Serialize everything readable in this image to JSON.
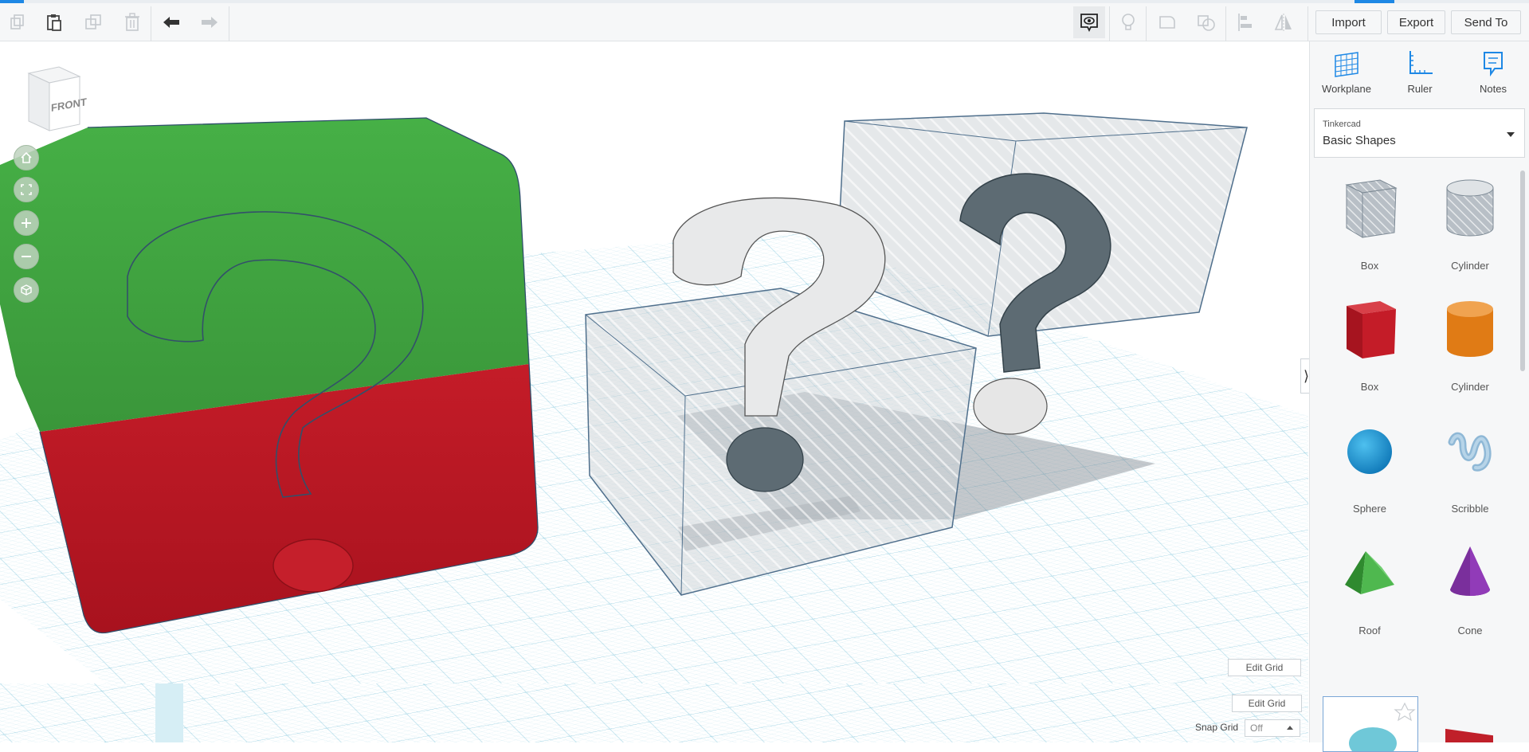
{
  "toolbar": {
    "icons": [
      "copy-icon",
      "paste-icon",
      "duplicate-icon",
      "delete-icon",
      "undo-icon",
      "redo-icon"
    ],
    "right_icons": [
      "show-all-icon",
      "light-bulb-icon",
      "group-icon",
      "ungroup-icon",
      "align-icon",
      "mirror-icon"
    ],
    "import_label": "Import",
    "export_label": "Export",
    "send_to_label": "Send To"
  },
  "viewport": {
    "viewcube_label": "FRONT",
    "nav_icons": [
      "home-icon",
      "fit-icon",
      "zoom-in-icon",
      "zoom-out-icon",
      "perspective-icon"
    ],
    "edit_grid_label": "Edit Grid"
  },
  "bottom_bar": {
    "edit_grid_label": "Edit Grid",
    "snap_grid_label": "Snap Grid",
    "snap_grid_value": "Off"
  },
  "panel": {
    "tools": [
      {
        "icon": "workplane-icon",
        "label": "Workplane"
      },
      {
        "icon": "ruler-icon",
        "label": "Ruler"
      },
      {
        "icon": "notes-icon",
        "label": "Notes"
      }
    ],
    "library": {
      "owner": "Tinkercad",
      "name": "Basic Shapes"
    },
    "shapes": [
      {
        "label": "Box",
        "icon": "box-hole-icon"
      },
      {
        "label": "Cylinder",
        "icon": "cylinder-hole-icon"
      },
      {
        "label": "Box",
        "icon": "box-icon"
      },
      {
        "label": "Cylinder",
        "icon": "cylinder-icon"
      },
      {
        "label": "Sphere",
        "icon": "sphere-icon"
      },
      {
        "label": "Scribble",
        "icon": "scribble-icon"
      },
      {
        "label": "Roof",
        "icon": "roof-icon"
      },
      {
        "label": "Cone",
        "icon": "cone-icon"
      }
    ]
  },
  "colors": {
    "green": "#3e9e3e",
    "red": "#bf1a26",
    "grid": "#bfe3ee",
    "hole": "#b8bfc6",
    "accent": "#1e88e5"
  }
}
